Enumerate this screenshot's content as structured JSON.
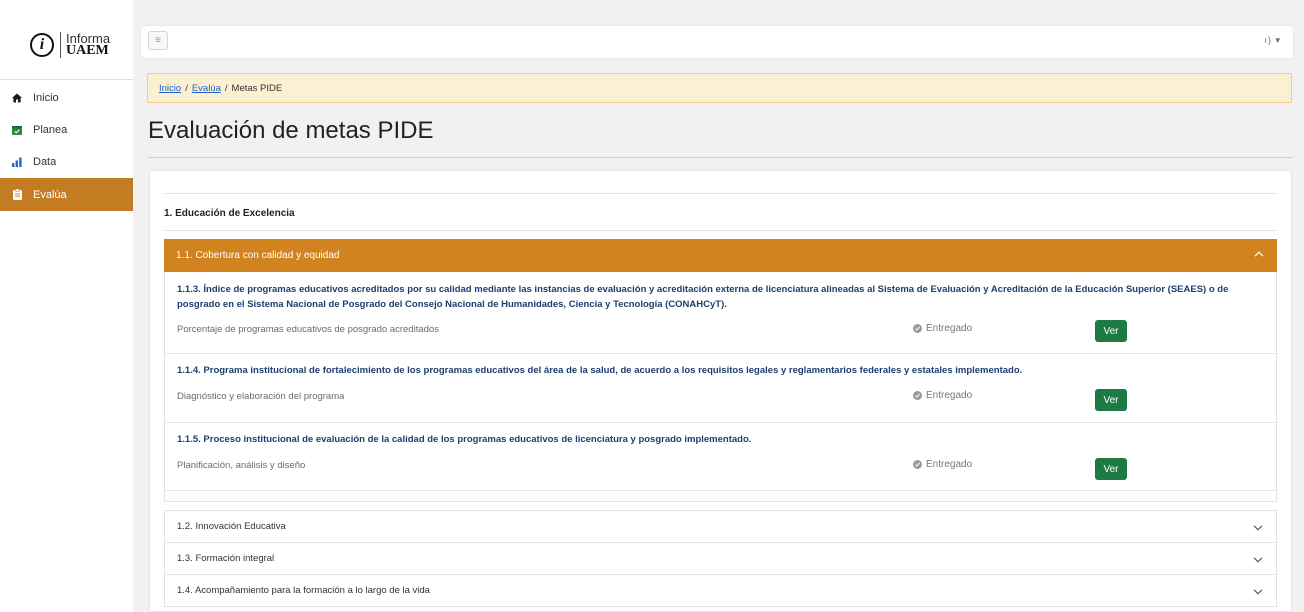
{
  "logo": {
    "top": "Informa",
    "bottom": "UAEM"
  },
  "sidebar": {
    "items": [
      {
        "label": "Inicio",
        "icon": "home-icon"
      },
      {
        "label": "Planea",
        "icon": "calendar-icon"
      },
      {
        "label": "Data",
        "icon": "bar-chart-icon"
      },
      {
        "label": "Evalúa",
        "icon": "clipboard-icon"
      }
    ],
    "active": "Evalúa"
  },
  "topbar": {
    "user_caret": "ı) ▾"
  },
  "breadcrumb": {
    "home": "Inicio",
    "section": "Evalúa",
    "current": "Metas PIDE",
    "separator": "/"
  },
  "page": {
    "title": "Evaluación de metas PIDE"
  },
  "section": {
    "title": "1. Educación de Excelencia"
  },
  "accordion_open": {
    "title": "1.1. Cobertura con calidad y equidad",
    "items": [
      {
        "title": "1.1.3. Índice de programas educativos acreditados por su calidad mediante las instancias de evaluación y acreditación externa de licenciatura alineadas al Sistema de Evaluación y Acreditación de la Educación Superior (SEAES) o de posgrado en el Sistema Nacional de Posgrado del Consejo Nacional de Humanidades, Ciencia y Tecnología (CONAHCyT).",
        "sub": "Porcentaje de programas educativos de posgrado acreditados",
        "status": "Entregado",
        "button": "Ver"
      },
      {
        "title": "1.1.4. Programa institucional de fortalecimiento de los programas educativos del área de la salud, de acuerdo a los requisitos legales y reglamentarios federales y estatales implementado.",
        "sub": "Diagnóstico y elaboración del programa",
        "status": "Entregado",
        "button": "Ver"
      },
      {
        "title": "1.1.5. Proceso institucional de evaluación de la calidad de los programas educativos de licenciatura y posgrado implementado.",
        "sub": "Planificación, análisis y diseño",
        "status": "Entregado",
        "button": "Ver"
      }
    ]
  },
  "accordion_closed": [
    {
      "title": "1.2. Innovación Educativa"
    },
    {
      "title": "1.3. Formación integral"
    },
    {
      "title": "1.4. Acompañamiento para la formación a lo largo de la vida"
    }
  ],
  "colors": {
    "accent": "#d1831f",
    "sidebar_active": "#c47c22",
    "button": "#1e7a45",
    "link": "#2260c4",
    "item_title": "#1e3e6f"
  }
}
